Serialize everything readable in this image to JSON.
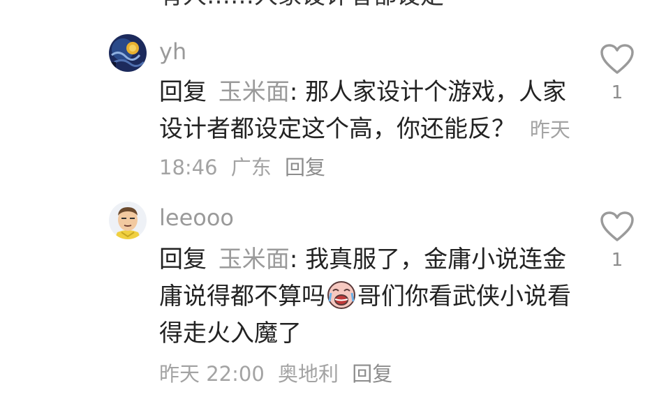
{
  "top_partial_text": "有人……人家设计者都设定",
  "comments": [
    {
      "username": "yh",
      "reply_word": "回复",
      "reply_target": "玉米面",
      "colon": ":",
      "text": "那人家设计个游戏，人家设计者都设定这个高，你还能反？",
      "time": "昨天 18:46",
      "location": "广东",
      "reply_action": "回复",
      "likes": "1",
      "avatar": "starry-night-avatar"
    },
    {
      "username": "leeooo",
      "reply_word": "回复",
      "reply_target": "玉米面",
      "colon": ":",
      "text_before_emoji": "我真服了，金庸小说连金庸说得都不算吗",
      "emoji": "crying-face-emoji",
      "text_after_emoji": "哥们你看武侠小说看得走火入魔了",
      "time": "昨天 22:00",
      "location": "奥地利",
      "reply_action": "回复",
      "likes": "1",
      "avatar": "cartoon-man-avatar"
    }
  ],
  "colors": {
    "text": "#222222",
    "muted": "#9a9a9a",
    "icon_stroke": "#9a9a9a"
  }
}
